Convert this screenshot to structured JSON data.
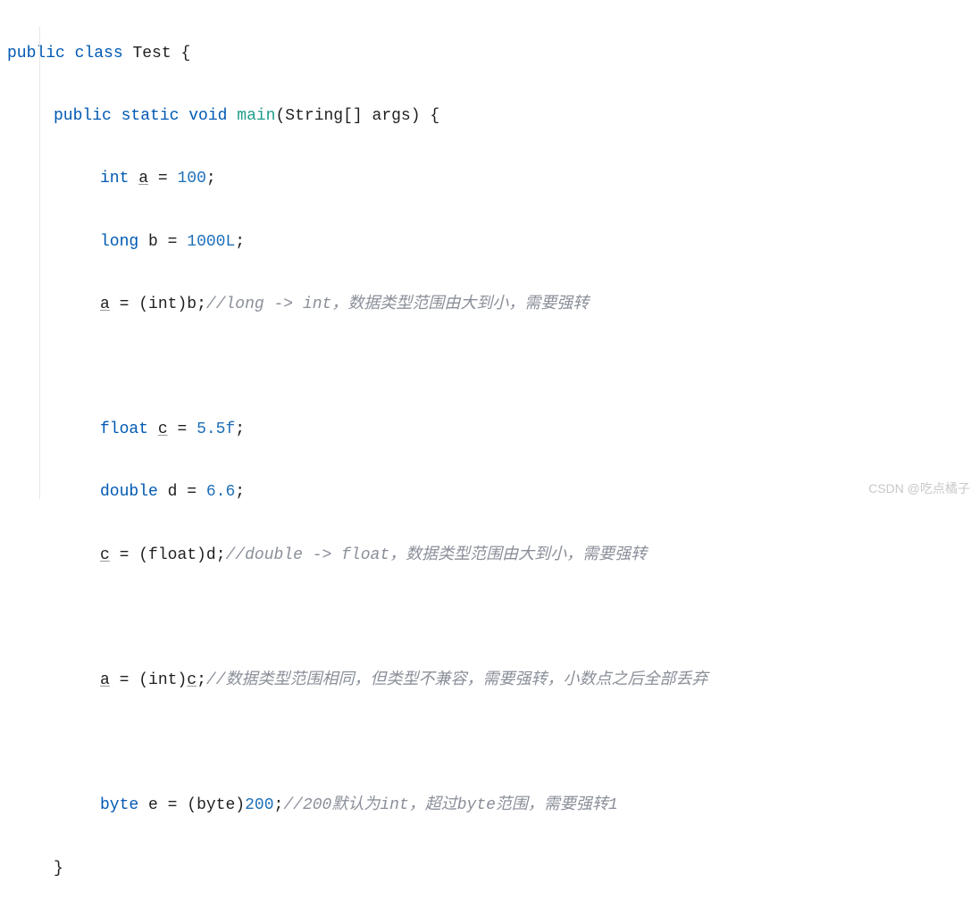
{
  "code": {
    "l1": {
      "public": "public",
      "class": "class",
      "test": "Test",
      "brace": "{"
    },
    "l2": {
      "public": "public",
      "static": "static",
      "void": "void",
      "main": "main",
      "params": "(String[] args)",
      "brace": "{"
    },
    "l3": {
      "kw": "int",
      "var": "a",
      "eq": "=",
      "val": "100",
      "semi": ";"
    },
    "l4": {
      "kw": "long",
      "var": "b",
      "eq": "=",
      "val": "1000L",
      "semi": ";"
    },
    "l5": {
      "var": "a",
      "eq": "=",
      "cast": "(int)",
      "rhs": "b",
      "semi": ";",
      "comment": "//long -> int，数据类型范围由大到小，需要强转"
    },
    "l6": {
      "kw": "float",
      "var": "c",
      "eq": "=",
      "val": "5.5f",
      "semi": ";"
    },
    "l7": {
      "kw": "double",
      "var": "d",
      "eq": "=",
      "val": "6.6",
      "semi": ";"
    },
    "l8": {
      "var": "c",
      "eq": "=",
      "cast": "(float)",
      "rhs": "d",
      "semi": ";",
      "comment": "//double -> float，数据类型范围由大到小，需要强转"
    },
    "l9": {
      "var": "a",
      "eq": "=",
      "cast": "(int)",
      "rhs": "c",
      "semi": ";",
      "comment": "//数据类型范围相同，但类型不兼容，需要强转，小数点之后全部丢弃"
    },
    "l10": {
      "kw": "byte",
      "var": "e",
      "eq": "=",
      "cast": "(byte)",
      "val": "200",
      "semi": ";",
      "comment": "//200默认为int，超过byte范围，需要强转1"
    },
    "l11": {
      "brace": "}"
    }
  },
  "watermark": "CSDN @吃点橘子"
}
